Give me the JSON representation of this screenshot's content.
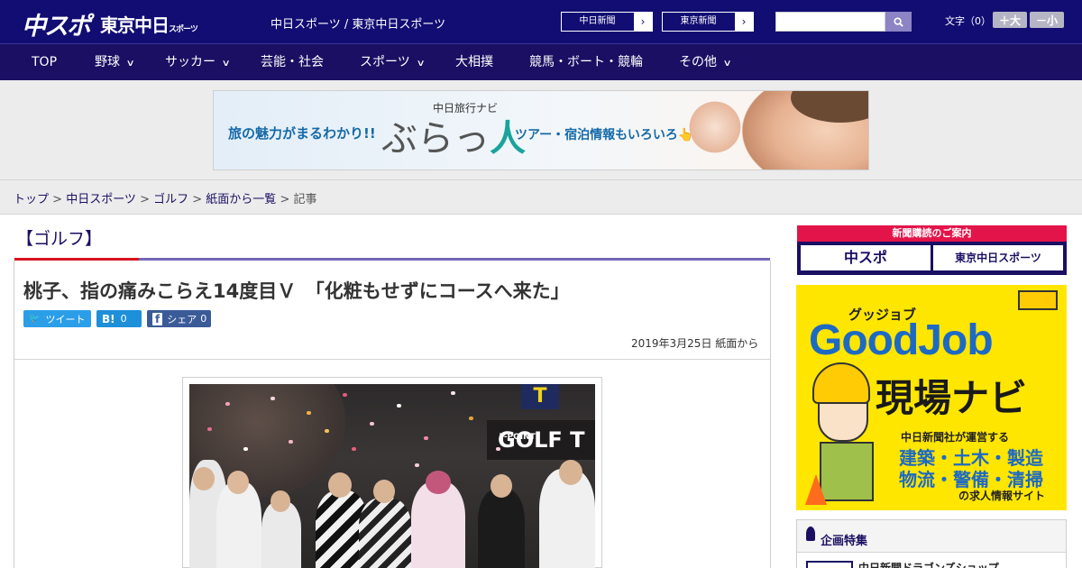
{
  "header": {
    "logo_main": "中スポ",
    "logo_tokyo": "東京中日",
    "logo_tokyo_small": "スポーツ",
    "site_name": "中日スポーツ / 東京中日スポーツ",
    "paper_links": [
      {
        "label": "中日新聞",
        "arrow": "›"
      },
      {
        "label": "東京新聞",
        "arrow": "›"
      }
    ],
    "search_placeholder": "",
    "font_label": "文字（0）",
    "font_larger": "＋大",
    "font_smaller": "－小"
  },
  "nav": [
    {
      "label": "TOP",
      "dropdown": false
    },
    {
      "label": "野球",
      "dropdown": true
    },
    {
      "label": "サッカー",
      "dropdown": true
    },
    {
      "label": "芸能・社会",
      "dropdown": false
    },
    {
      "label": "スポーツ",
      "dropdown": true
    },
    {
      "label": "大相撲",
      "dropdown": false
    },
    {
      "label": "競馬・ボート・競輪",
      "dropdown": false
    },
    {
      "label": "その他",
      "dropdown": true
    }
  ],
  "nav_chevron": "∨",
  "ad": {
    "left_text": "旅の魅力がまるわかり!!",
    "sub_title": "中日旅行ナビ",
    "logo_text": "ぶらっ",
    "logo_accent": "人",
    "right_text": "ツアー・宿泊情報もいろいろ👆"
  },
  "breadcrumb": {
    "items": [
      "トップ",
      "中日スポーツ",
      "ゴルフ",
      "紙面から一覧"
    ],
    "current": "記事",
    "separator": " > "
  },
  "article": {
    "section": "【ゴルフ】",
    "headline": "桃子、指の痛みこらえ14度目Ｖ　「化粧もせずにコースへ来た」",
    "share": {
      "tweet_icon": "🐦",
      "tweet_label": "ツイート",
      "hatena_icon": "B!",
      "hatena_count": "0",
      "fb_icon": "f",
      "fb_label": "シェア",
      "fb_count": "0"
    },
    "date": "2019年3月25日",
    "source": "紙面から",
    "photo_banner": "GOLF T",
    "photo_banner_logo": "T",
    "photo_banner_point": "T-POINT"
  },
  "sidebar": {
    "subscribe_header": "新聞購読のご案内",
    "subscribe_a": "中スポ",
    "subscribe_b": "東京中日スポーツ",
    "goodjob": {
      "sub": "グッジョブ",
      "title": "GoodJob",
      "main": "現場ナビ",
      "line1": "中日新聞社が運営する",
      "line2": "建築・土木・製造",
      "line3": "物流・警備・清掃",
      "foot": "の求人情報サイト"
    },
    "kikaku_title": "企画特集",
    "kikaku_item": "中日新聞ドラゴンズショップ"
  },
  "colors": {
    "header_bg": "#120d73",
    "nav_bg": "#1a0f63",
    "accent_red": "#d7141d",
    "accent_purple": "#7566b7",
    "twitter": "#2b9ee8",
    "hatena": "#1e8fd9",
    "facebook": "#3b5b98"
  }
}
